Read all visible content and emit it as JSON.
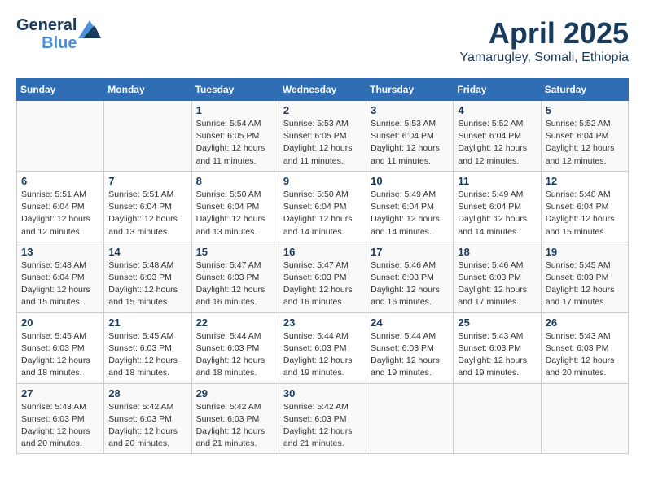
{
  "header": {
    "logo_general": "General",
    "logo_blue": "Blue",
    "month": "April 2025",
    "location": "Yamarugley, Somali, Ethiopia"
  },
  "calendar": {
    "days_of_week": [
      "Sunday",
      "Monday",
      "Tuesday",
      "Wednesday",
      "Thursday",
      "Friday",
      "Saturday"
    ],
    "weeks": [
      [
        {
          "day": "",
          "info": ""
        },
        {
          "day": "",
          "info": ""
        },
        {
          "day": "1",
          "info": "Sunrise: 5:54 AM\nSunset: 6:05 PM\nDaylight: 12 hours and 11 minutes."
        },
        {
          "day": "2",
          "info": "Sunrise: 5:53 AM\nSunset: 6:05 PM\nDaylight: 12 hours and 11 minutes."
        },
        {
          "day": "3",
          "info": "Sunrise: 5:53 AM\nSunset: 6:04 PM\nDaylight: 12 hours and 11 minutes."
        },
        {
          "day": "4",
          "info": "Sunrise: 5:52 AM\nSunset: 6:04 PM\nDaylight: 12 hours and 12 minutes."
        },
        {
          "day": "5",
          "info": "Sunrise: 5:52 AM\nSunset: 6:04 PM\nDaylight: 12 hours and 12 minutes."
        }
      ],
      [
        {
          "day": "6",
          "info": "Sunrise: 5:51 AM\nSunset: 6:04 PM\nDaylight: 12 hours and 12 minutes."
        },
        {
          "day": "7",
          "info": "Sunrise: 5:51 AM\nSunset: 6:04 PM\nDaylight: 12 hours and 13 minutes."
        },
        {
          "day": "8",
          "info": "Sunrise: 5:50 AM\nSunset: 6:04 PM\nDaylight: 12 hours and 13 minutes."
        },
        {
          "day": "9",
          "info": "Sunrise: 5:50 AM\nSunset: 6:04 PM\nDaylight: 12 hours and 14 minutes."
        },
        {
          "day": "10",
          "info": "Sunrise: 5:49 AM\nSunset: 6:04 PM\nDaylight: 12 hours and 14 minutes."
        },
        {
          "day": "11",
          "info": "Sunrise: 5:49 AM\nSunset: 6:04 PM\nDaylight: 12 hours and 14 minutes."
        },
        {
          "day": "12",
          "info": "Sunrise: 5:48 AM\nSunset: 6:04 PM\nDaylight: 12 hours and 15 minutes."
        }
      ],
      [
        {
          "day": "13",
          "info": "Sunrise: 5:48 AM\nSunset: 6:04 PM\nDaylight: 12 hours and 15 minutes."
        },
        {
          "day": "14",
          "info": "Sunrise: 5:48 AM\nSunset: 6:03 PM\nDaylight: 12 hours and 15 minutes."
        },
        {
          "day": "15",
          "info": "Sunrise: 5:47 AM\nSunset: 6:03 PM\nDaylight: 12 hours and 16 minutes."
        },
        {
          "day": "16",
          "info": "Sunrise: 5:47 AM\nSunset: 6:03 PM\nDaylight: 12 hours and 16 minutes."
        },
        {
          "day": "17",
          "info": "Sunrise: 5:46 AM\nSunset: 6:03 PM\nDaylight: 12 hours and 16 minutes."
        },
        {
          "day": "18",
          "info": "Sunrise: 5:46 AM\nSunset: 6:03 PM\nDaylight: 12 hours and 17 minutes."
        },
        {
          "day": "19",
          "info": "Sunrise: 5:45 AM\nSunset: 6:03 PM\nDaylight: 12 hours and 17 minutes."
        }
      ],
      [
        {
          "day": "20",
          "info": "Sunrise: 5:45 AM\nSunset: 6:03 PM\nDaylight: 12 hours and 18 minutes."
        },
        {
          "day": "21",
          "info": "Sunrise: 5:45 AM\nSunset: 6:03 PM\nDaylight: 12 hours and 18 minutes."
        },
        {
          "day": "22",
          "info": "Sunrise: 5:44 AM\nSunset: 6:03 PM\nDaylight: 12 hours and 18 minutes."
        },
        {
          "day": "23",
          "info": "Sunrise: 5:44 AM\nSunset: 6:03 PM\nDaylight: 12 hours and 19 minutes."
        },
        {
          "day": "24",
          "info": "Sunrise: 5:44 AM\nSunset: 6:03 PM\nDaylight: 12 hours and 19 minutes."
        },
        {
          "day": "25",
          "info": "Sunrise: 5:43 AM\nSunset: 6:03 PM\nDaylight: 12 hours and 19 minutes."
        },
        {
          "day": "26",
          "info": "Sunrise: 5:43 AM\nSunset: 6:03 PM\nDaylight: 12 hours and 20 minutes."
        }
      ],
      [
        {
          "day": "27",
          "info": "Sunrise: 5:43 AM\nSunset: 6:03 PM\nDaylight: 12 hours and 20 minutes."
        },
        {
          "day": "28",
          "info": "Sunrise: 5:42 AM\nSunset: 6:03 PM\nDaylight: 12 hours and 20 minutes."
        },
        {
          "day": "29",
          "info": "Sunrise: 5:42 AM\nSunset: 6:03 PM\nDaylight: 12 hours and 21 minutes."
        },
        {
          "day": "30",
          "info": "Sunrise: 5:42 AM\nSunset: 6:03 PM\nDaylight: 12 hours and 21 minutes."
        },
        {
          "day": "",
          "info": ""
        },
        {
          "day": "",
          "info": ""
        },
        {
          "day": "",
          "info": ""
        }
      ]
    ]
  }
}
